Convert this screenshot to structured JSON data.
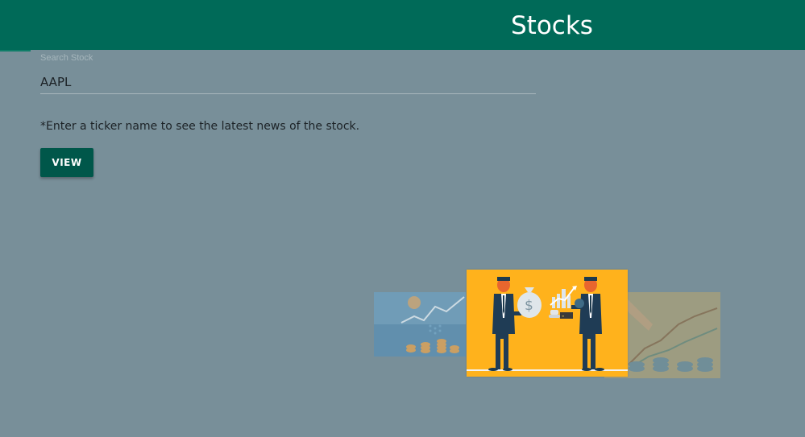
{
  "header": {
    "title": "Stocks"
  },
  "search": {
    "label": "Search Stock",
    "value": "AAPL"
  },
  "helper_text": "*Enter a ticker name to see the latest news of the stock.",
  "actions": {
    "view_label": "VIEW"
  },
  "carousel": {
    "slides": [
      {
        "icon": "stock-chart-coins-illustration"
      },
      {
        "icon": "business-deal-illustration",
        "money_symbol": "$"
      },
      {
        "icon": "coin-stacks-chart-illustration"
      }
    ]
  },
  "colors": {
    "header": "#006a58",
    "button": "#00574a",
    "background": "#788f99",
    "slide_accent": "#ffb21c"
  }
}
